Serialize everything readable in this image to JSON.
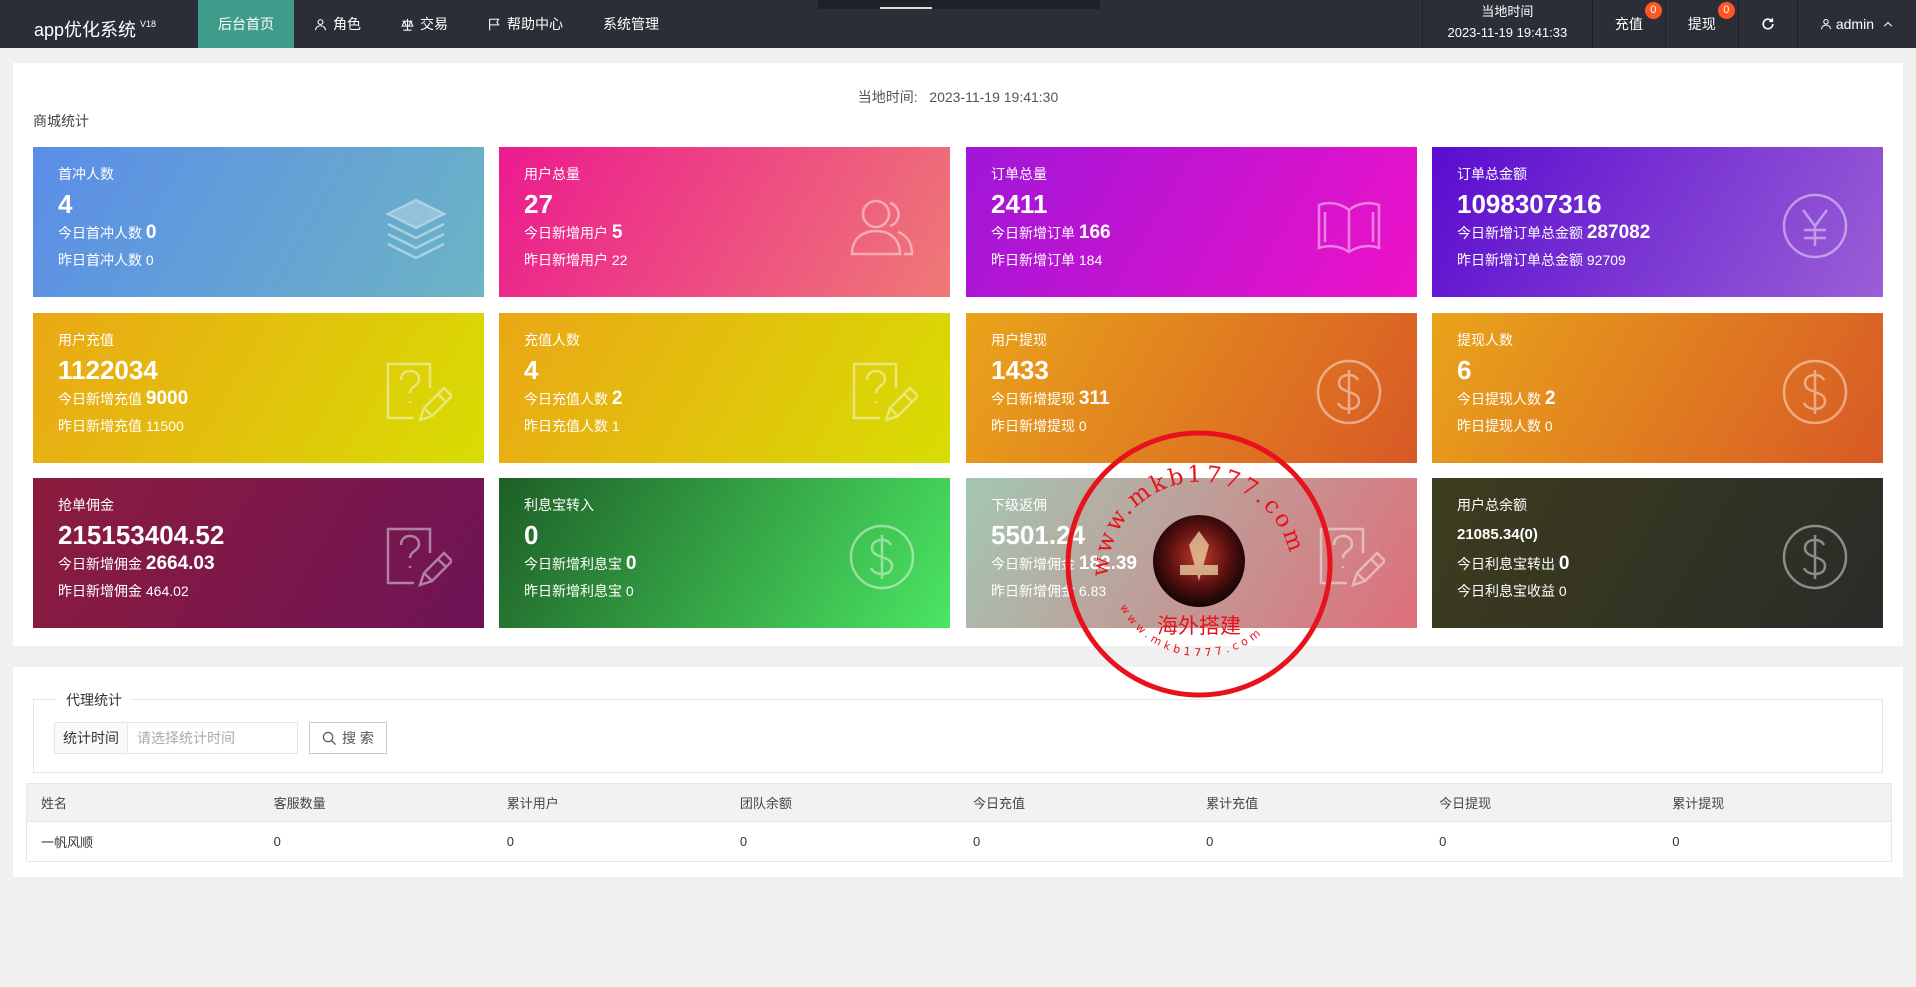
{
  "app": {
    "name": "app优化系统",
    "version": "V18"
  },
  "nav": [
    {
      "label": "后台首页",
      "icon": "home-icon",
      "active": true
    },
    {
      "label": "角色",
      "icon": "user-icon"
    },
    {
      "label": "交易",
      "icon": "scale-icon"
    },
    {
      "label": "帮助中心",
      "icon": "flag-icon"
    },
    {
      "label": "系统管理",
      "icon": ""
    }
  ],
  "header": {
    "time_title": "当地时间",
    "time_value": "2023-11-19 19:41:33",
    "recharge": {
      "label": "充值",
      "badge": "0"
    },
    "withdraw": {
      "label": "提现",
      "badge": "0"
    },
    "user": "admin"
  },
  "stats": {
    "local_time": "当地时间:   2023-11-19 19:41:30",
    "section_title": "商城统计",
    "cards": [
      {
        "label": "首冲人数",
        "value": "4",
        "today_label": "今日首冲人数",
        "today_value": "0",
        "yesterday": "昨日首冲人数 0",
        "icon": "layers-icon",
        "gradient": [
          "#5b8de8",
          "#6cb4c4"
        ]
      },
      {
        "label": "用户总量",
        "value": "27",
        "today_label": "今日新增用户",
        "today_value": "5",
        "yesterday": "昨日新增用户 22",
        "icon": "users-icon",
        "gradient": [
          "#ec1a8f",
          "#ef7a76"
        ]
      },
      {
        "label": "订单总量",
        "value": "2411",
        "today_label": "今日新增订单",
        "today_value": "166",
        "yesterday": "昨日新增订单 184",
        "icon": "book-icon",
        "gradient": [
          "#a016d8",
          "#ee12c8"
        ]
      },
      {
        "label": "订单总金额",
        "value": "1098307316",
        "today_label": "今日新增订单总金额",
        "today_value": "287082",
        "yesterday": "昨日新增订单总金额 92709",
        "icon": "yen-icon",
        "gradient": [
          "#5a0ccf",
          "#9a5fd6"
        ]
      },
      {
        "label": "用户充值",
        "value": "1122034",
        "today_label": "今日新增充值",
        "today_value": "9000",
        "yesterday": "昨日新增充值 11500",
        "icon": "edit-question-icon",
        "gradient": [
          "#eba715",
          "#d8dd03"
        ]
      },
      {
        "label": "充值人数",
        "value": "4",
        "today_label": "今日充值人数",
        "today_value": "2",
        "yesterday": "昨日充值人数 1",
        "icon": "edit-question-icon",
        "gradient": [
          "#eba715",
          "#d8dd03"
        ]
      },
      {
        "label": "用户提现",
        "value": "1433",
        "today_label": "今日新增提现",
        "today_value": "311",
        "yesterday": "昨日新增提现 0",
        "icon": "dollar-icon",
        "gradient": [
          "#e9a41a",
          "#d85926"
        ]
      },
      {
        "label": "提现人数",
        "value": "6",
        "today_label": "今日提现人数",
        "today_value": "2",
        "yesterday": "昨日提现人数 0",
        "icon": "dollar-icon",
        "gradient": [
          "#e9a41a",
          "#d85926"
        ]
      },
      {
        "label": "抢单佣金",
        "value": "215153404.52",
        "today_label": "今日新增佣金",
        "today_value": "2664.03",
        "yesterday": "昨日新增佣金 464.02",
        "icon": "edit-question-icon",
        "gradient": [
          "#8c1c3d",
          "#6d1456"
        ]
      },
      {
        "label": "利息宝转入",
        "value": "0",
        "today_label": "今日新增利息宝",
        "today_value": "0",
        "yesterday": "昨日新增利息宝 0",
        "icon": "dollar-icon",
        "gradient": [
          "#1e5f27",
          "#4be663"
        ]
      },
      {
        "label": "下级返佣",
        "value": "5501.24",
        "today_label": "今日新增佣金",
        "today_value": "182.39",
        "yesterday": "昨日新增佣金 6.83",
        "icon": "edit-question-icon",
        "gradient": [
          "#a3c7b3",
          "#de6f7a"
        ]
      },
      {
        "label": "用户总余额",
        "value": "21085.34(0)",
        "today_label": "今日利息宝转出",
        "today_value": "0",
        "yesterday": "今日利息宝收益 0",
        "icon": "dollar-icon",
        "gradient": [
          "#3d3d1f",
          "#2a2b28"
        ],
        "small_value": true
      }
    ]
  },
  "agent": {
    "title": "代理统计",
    "filter_label": "统计时间",
    "filter_placeholder": "请选择统计时间",
    "search_label": "搜 索",
    "columns": [
      "姓名",
      "客服数量",
      "累计用户",
      "团队余额",
      "今日充值",
      "累计充值",
      "今日提现",
      "累计提现"
    ],
    "rows": [
      [
        "一帆风顺",
        "0",
        "0",
        "0",
        "0",
        "0",
        "0",
        "0"
      ]
    ]
  },
  "watermark": {
    "url_top": "www.mkb1777.com",
    "name": "海外搭建",
    "url_bottom": "www.mkb1777.com",
    "color": "#e8121c"
  }
}
